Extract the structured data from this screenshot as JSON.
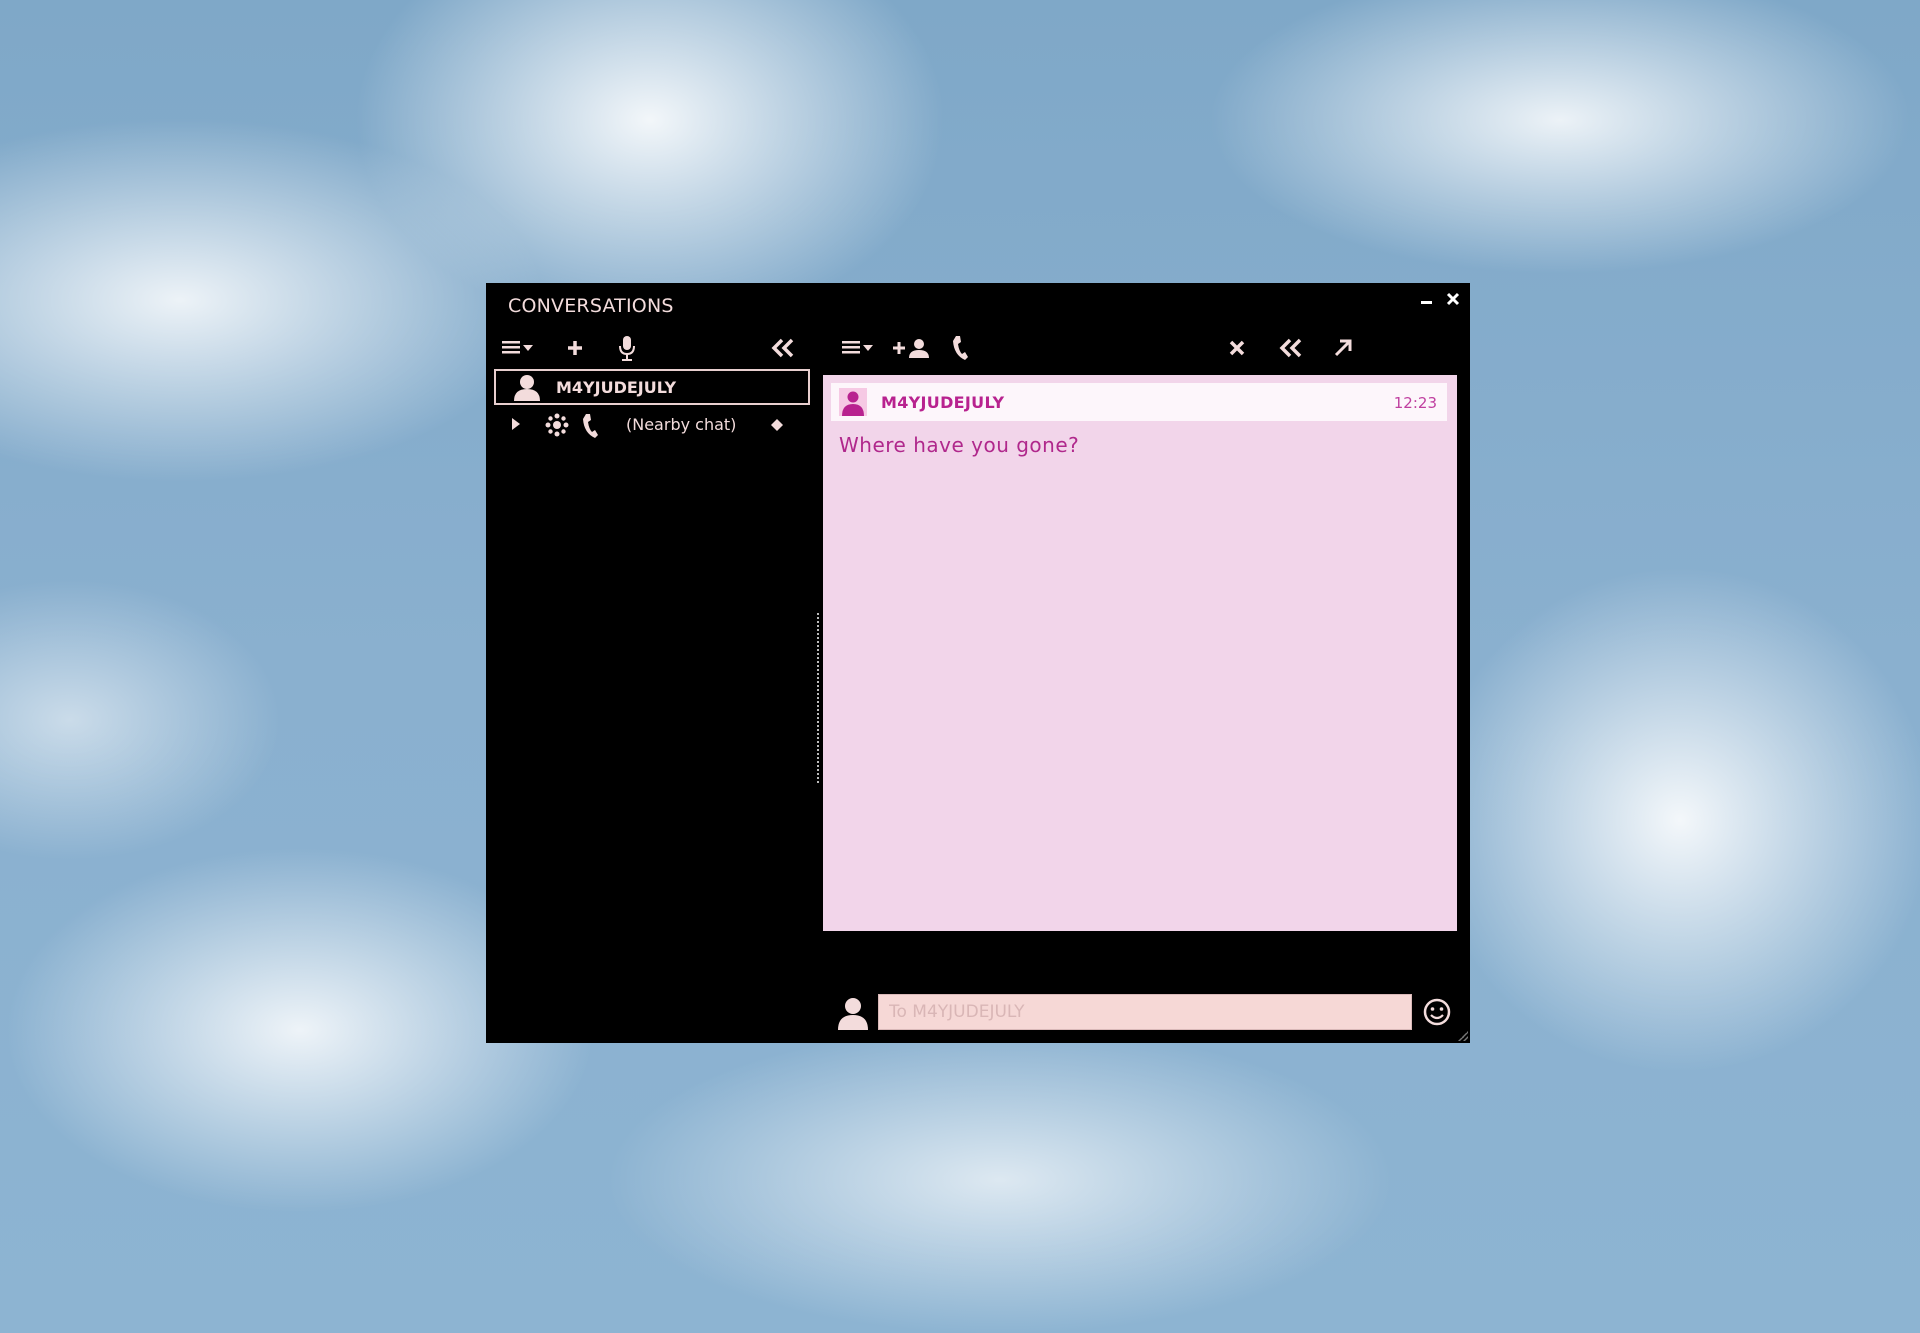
{
  "window": {
    "title": "CONVERSATIONS",
    "minimize_icon": "minimize-icon",
    "close_icon": "close-icon"
  },
  "left_toolbar": {
    "icons": [
      "menu-dropdown-icon",
      "add-icon",
      "microphone-icon",
      "collapse-double-chevron-icon"
    ]
  },
  "conversations": {
    "items": [
      {
        "name": "M4YJUDEJULY",
        "icon": "avatar-icon",
        "selected": true
      }
    ],
    "nearby": {
      "label": "(Nearby chat)",
      "icons": [
        "expand-arrow-icon",
        "nearby-voice-icon",
        "phone-icon",
        "diamond-icon"
      ]
    }
  },
  "right_toolbar": {
    "icons": [
      "menu-dropdown-icon",
      "add-people-icon",
      "phone-icon",
      "close-conversation-icon",
      "collapse-double-chevron-icon",
      "tear-off-icon"
    ]
  },
  "chat": {
    "messages": [
      {
        "sender": "M4YJUDEJULY",
        "time": "12:23",
        "text": "Where have you gone?"
      }
    ]
  },
  "input": {
    "placeholder": "To M4YJUDEJULY",
    "avatar_icon": "avatar-icon",
    "emoji_icon": "smiley-icon"
  },
  "colors": {
    "window_bg": "#000000",
    "chat_bg": "#f2d5ea",
    "accent": "#b8228f",
    "input_bg": "#f6d8d6"
  }
}
